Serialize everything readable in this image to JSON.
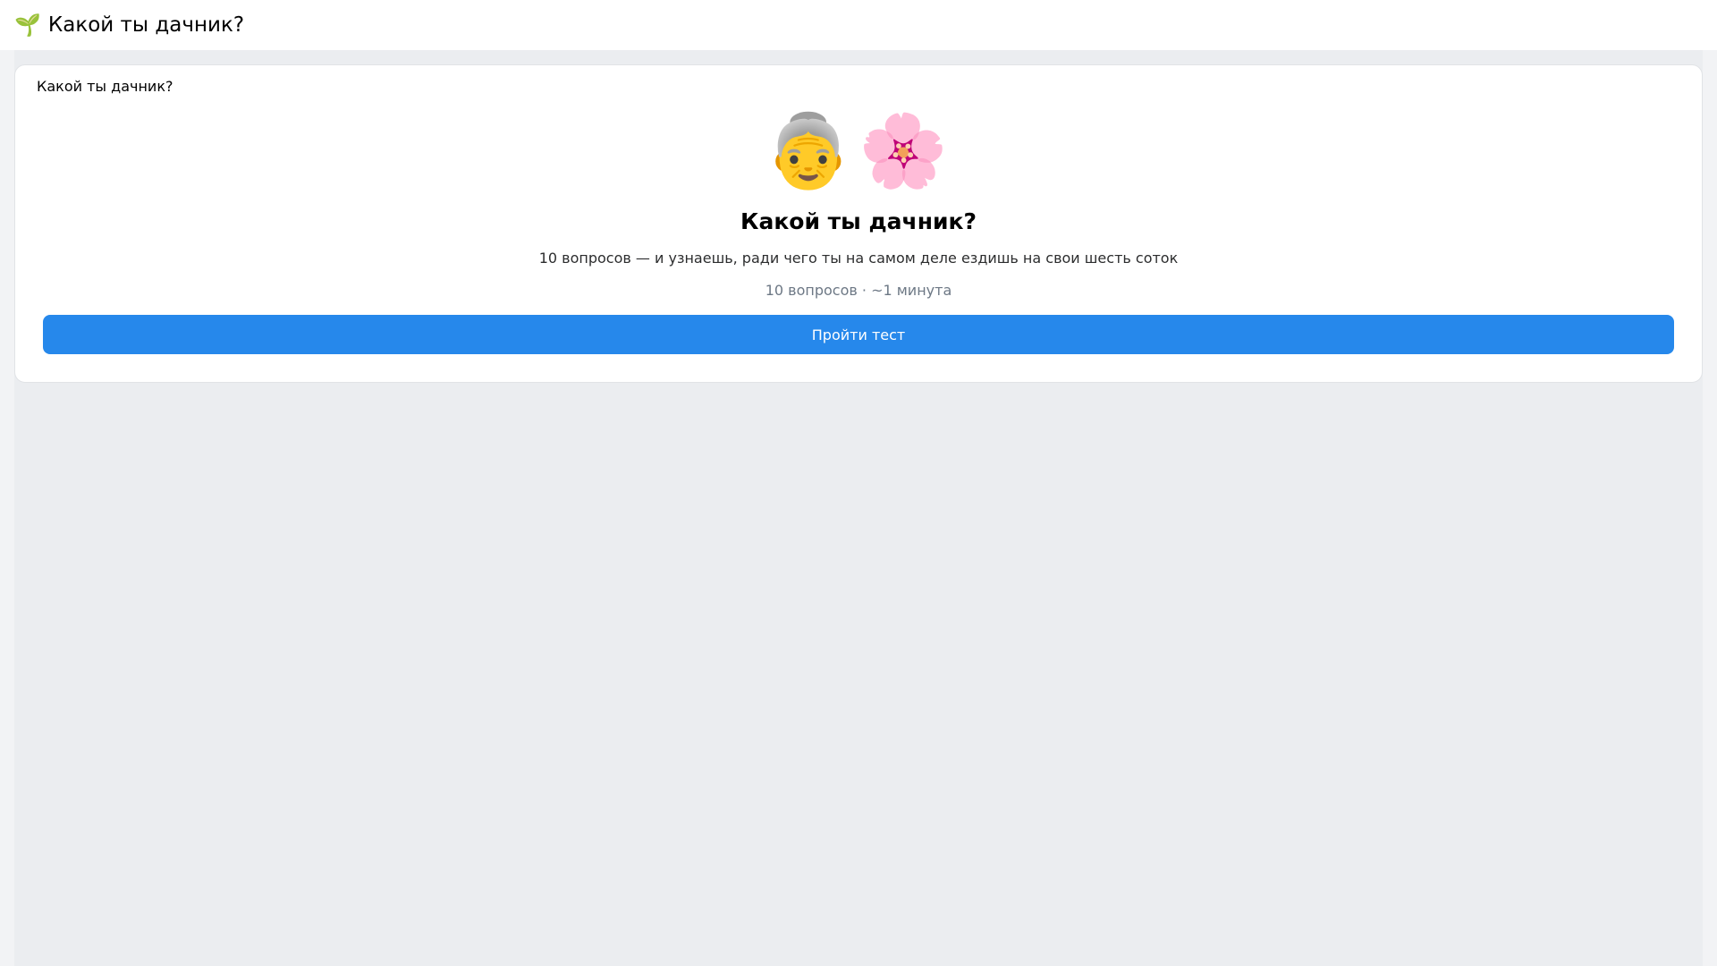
{
  "header": {
    "icon": "🌱",
    "icon_name": "seedling-icon",
    "title": "Какой ты дачник?"
  },
  "card": {
    "header_title": "Какой ты дачник?",
    "hero_emoji": "👵🌸",
    "hero_icon_names": [
      "old-woman-icon",
      "cherry-blossom-icon"
    ],
    "title": "Какой ты дачник?",
    "description": "10 вопросов — и узнаешь, ради чего ты на самом деле ездишь на свои шесть соток",
    "meta": "10 вопросов · ~1 минута",
    "start_button_label": "Пройти тест"
  },
  "colors": {
    "accent": "#2688eb",
    "background": "#ebedf0",
    "card": "#ffffff"
  }
}
